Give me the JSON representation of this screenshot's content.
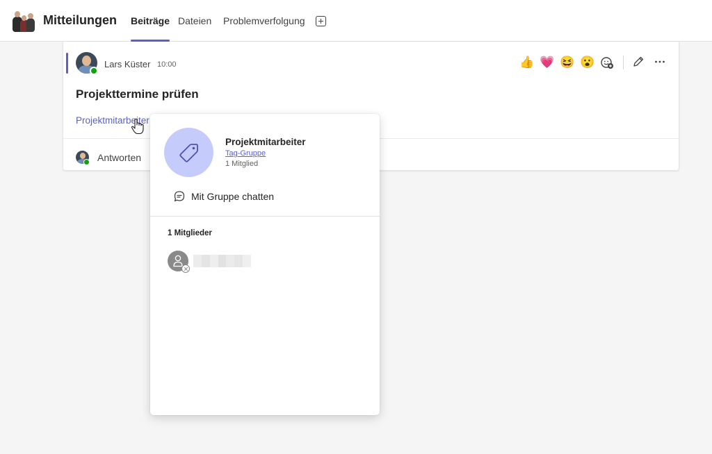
{
  "header": {
    "channel_title": "Mitteilungen",
    "tabs": [
      {
        "label": "Beiträge",
        "active": true
      },
      {
        "label": "Dateien",
        "active": false
      },
      {
        "label": "Problemverfolgung",
        "active": false
      }
    ],
    "add_tab_icon": "plus-square-icon"
  },
  "post": {
    "author": "Lars Küster",
    "time": "10:00",
    "subject": "Projekttermine prüfen",
    "mention": "Projektmitarbeiter",
    "reply_label": "Antworten",
    "reactions": [
      "👍",
      "💗",
      "😆",
      "😮"
    ],
    "reaction_icons": [
      "thumbs-up-icon",
      "heart-icon",
      "laugh-icon",
      "surprised-icon",
      "add-reaction-icon"
    ],
    "tools": [
      "edit-icon",
      "more-icon"
    ],
    "accent_color": "#5b5fc7"
  },
  "popup": {
    "group_name": "Projektmitarbeiter",
    "group_type": "Tag-Gruppe",
    "member_count": "1 Mitglied",
    "chat_button": "Mit Gruppe chatten",
    "members_heading": "1 Mitglieder",
    "tag_icon": "tag-icon",
    "tag_bg_color": "#c5cbfa"
  }
}
